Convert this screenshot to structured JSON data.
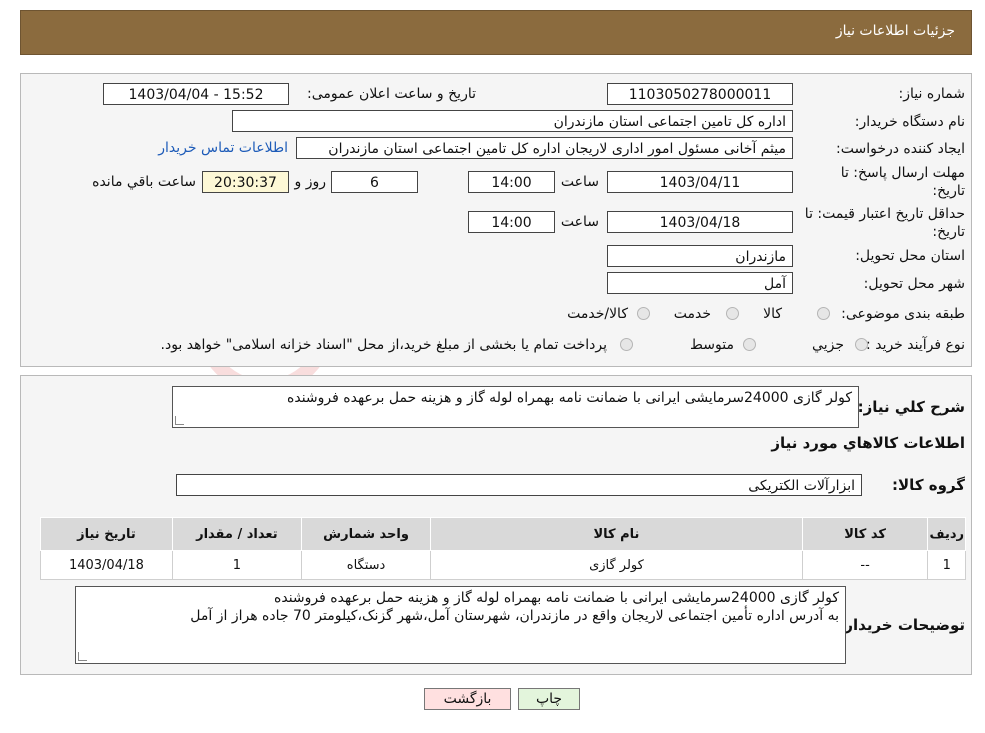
{
  "header": {
    "title": "جزئیات اطلاعات نیاز"
  },
  "form": {
    "need_number_label": "شماره نیاز:",
    "need_number": "1103050278000011",
    "announce_label": "تاریخ و ساعت اعلان عمومی:",
    "announce_value": "1403/04/04 - 15:52",
    "buyer_org_label": "نام دستگاه خریدار:",
    "buyer_org": "اداره کل تامین اجتماعی استان مازندران",
    "creator_label": "ایجاد کننده درخواست:",
    "creator": "میثم آخانی مسئول امور اداری لاریجان اداره کل تامین اجتماعی استان مازندران",
    "contact_link": "اطلاعات تماس خریدار",
    "deadline_label_1": "مهلت ارسال پاسخ: تا",
    "deadline_label_2": "تاریخ:",
    "deadline_date": "1403/04/11",
    "time_label": "ساعت",
    "deadline_time": "14:00",
    "days_value": "6",
    "days_label": "روز و",
    "remaining_time": "20:30:37",
    "remaining_label": "ساعت باقي مانده",
    "validity_label_1": "حداقل تاریخ اعتبار قیمت: تا",
    "validity_label_2": "تاریخ:",
    "validity_date": "1403/04/18",
    "validity_time": "14:00",
    "province_label": "استان محل تحویل:",
    "province": "مازندران",
    "city_label": "شهر محل تحویل:",
    "city": "آمل",
    "category_label": "طبقه بندی موضوعی:",
    "category_options": [
      "کالا",
      "خدمت",
      "کالا/خدمت"
    ],
    "process_label": "نوع فرآیند خرید :",
    "process_options": [
      "جزیي",
      "متوسط"
    ],
    "process_note": "پرداخت تمام یا بخشی از مبلغ خرید،از محل \"اسناد خزانه اسلامی\" خواهد بود."
  },
  "summary": {
    "desc_label": "شرح کلي نياز:",
    "desc": "کولر گازی 24000سرمایشی ایرانی با ضمانت نامه بهمراه لوله گاز و هزینه حمل برعهده فروشنده",
    "items_title": "اطلاعات کالاهاي مورد نياز",
    "group_label": "گروه کالا:",
    "group": "ابزارآلات الکتریکی"
  },
  "table": {
    "headers": [
      "رديف",
      "کد کالا",
      "نام کالا",
      "واحد شمارش",
      "تعداد / مقدار",
      "تاريخ نياز"
    ],
    "rows": [
      [
        "1",
        "--",
        "کولر گازی",
        "دستگاه",
        "1",
        "1403/04/18"
      ]
    ]
  },
  "notes": {
    "label": "توضیحات خریدار:",
    "line1": "کولر گازی 24000سرمایشی ایرانی با ضمانت نامه بهمراه لوله گاز و هزینه حمل برعهده فروشنده",
    "line2": "به آدرس اداره تأمین اجتماعی لاریجان واقع در مازندران، شهرستان آمل،شهر گزنک،کیلومتر 70 جاده هراز از آمل"
  },
  "buttons": {
    "print": "چاپ",
    "back": "بازگشت"
  },
  "colors": {
    "header_bg": "#8b6b3e",
    "back_button_bg": "#ffe0e0",
    "print_button_bg": "#e3f5dc",
    "link": "#1d5bb8"
  }
}
